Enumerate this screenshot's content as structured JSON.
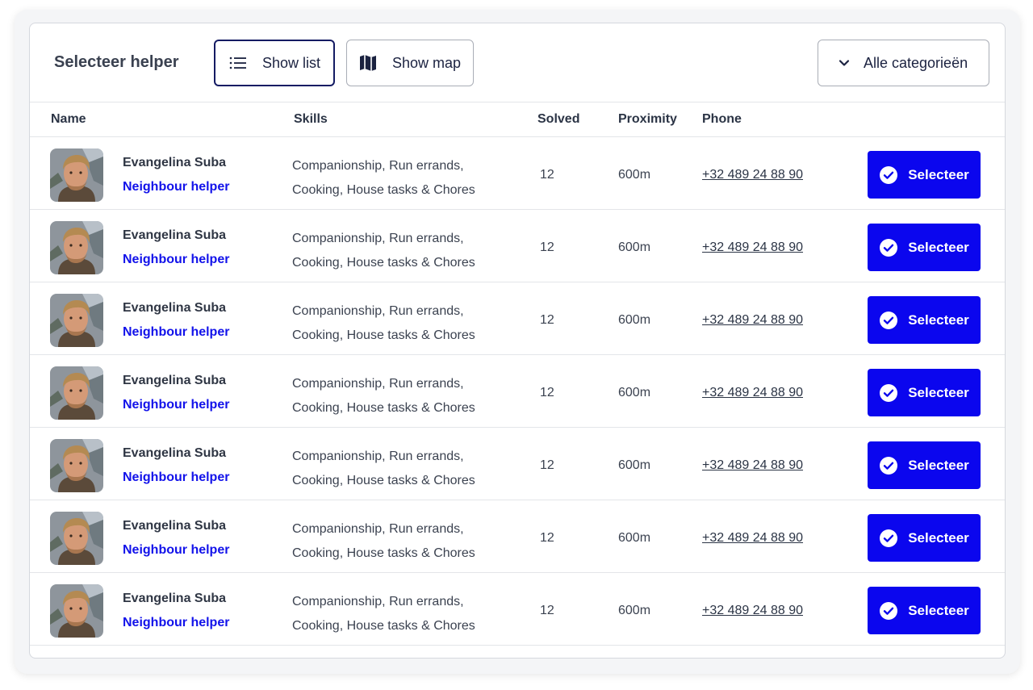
{
  "toolbar": {
    "title": "Selecteer helper",
    "show_list_label": "Show list",
    "show_map_label": "Show map",
    "category_label": "Alle categorieën"
  },
  "table": {
    "columns": {
      "name": "Name",
      "skills": "Skills",
      "solved": "Solved",
      "proximity": "Proximity",
      "phone": "Phone"
    },
    "rows": [
      {
        "name": "Evangelina Suba",
        "role": "Neighbour helper",
        "skills_line1": "Companionship, Run errands,",
        "skills_line2": "Cooking, House tasks & Chores",
        "solved": "12",
        "proximity": "600m",
        "phone": "+32 489 24 88 90",
        "button": "Selecteer"
      },
      {
        "name": "Evangelina Suba",
        "role": "Neighbour helper",
        "skills_line1": "Companionship, Run errands,",
        "skills_line2": "Cooking, House tasks & Chores",
        "solved": "12",
        "proximity": "600m",
        "phone": "+32 489 24 88 90",
        "button": "Selecteer"
      },
      {
        "name": "Evangelina Suba",
        "role": "Neighbour helper",
        "skills_line1": "Companionship, Run errands,",
        "skills_line2": "Cooking, House tasks & Chores",
        "solved": "12",
        "proximity": "600m",
        "phone": "+32 489 24 88 90",
        "button": "Selecteer"
      },
      {
        "name": "Evangelina Suba",
        "role": "Neighbour helper",
        "skills_line1": "Companionship, Run errands,",
        "skills_line2": "Cooking, House tasks & Chores",
        "solved": "12",
        "proximity": "600m",
        "phone": "+32 489 24 88 90",
        "button": "Selecteer"
      },
      {
        "name": "Evangelina Suba",
        "role": "Neighbour helper",
        "skills_line1": "Companionship, Run errands,",
        "skills_line2": "Cooking, House tasks & Chores",
        "solved": "12",
        "proximity": "600m",
        "phone": "+32 489 24 88 90",
        "button": "Selecteer"
      },
      {
        "name": "Evangelina Suba",
        "role": "Neighbour helper",
        "skills_line1": "Companionship, Run errands,",
        "skills_line2": "Cooking, House tasks & Chores",
        "solved": "12",
        "proximity": "600m",
        "phone": "+32 489 24 88 90",
        "button": "Selecteer"
      },
      {
        "name": "Evangelina Suba",
        "role": "Neighbour helper",
        "skills_line1": "Companionship, Run errands,",
        "skills_line2": "Cooking, House tasks & Chores",
        "solved": "12",
        "proximity": "600m",
        "phone": "+32 489 24 88 90",
        "button": "Selecteer"
      }
    ]
  },
  "colors": {
    "accent": "#0b06ee",
    "role_text": "#1212ea",
    "active_border": "#141b63"
  },
  "icons": {
    "list": "list-icon",
    "map": "map-icon",
    "chevron": "chevron-down-icon",
    "check": "check-circle-icon"
  }
}
